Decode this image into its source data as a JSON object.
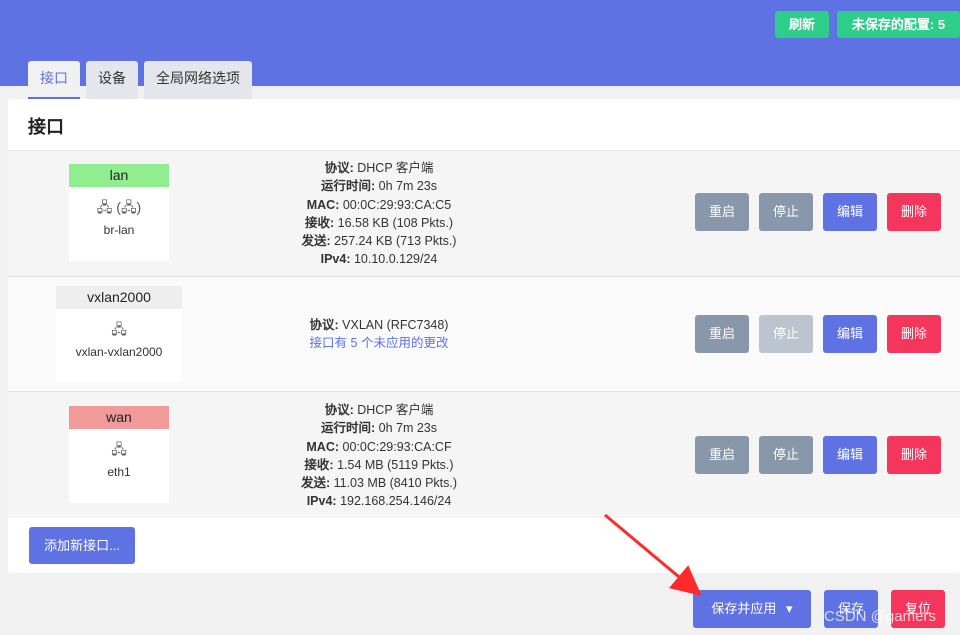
{
  "header": {
    "refresh_label": "刷新",
    "unsaved_label": "未保存的配置: 5"
  },
  "tabs": [
    {
      "label": "接口",
      "active": true
    },
    {
      "label": "设备",
      "active": false
    },
    {
      "label": "全局网络选项",
      "active": false
    }
  ],
  "panel": {
    "title": "接口"
  },
  "interfaces": [
    {
      "name": "lan",
      "badge_color": "#90ee90",
      "icons": "🖧 (🖧)",
      "device": "br-lan",
      "info": [
        {
          "k": "协议:",
          "v": " DHCP 客户端"
        },
        {
          "k": "运行时间:",
          "v": " 0h 7m 23s"
        },
        {
          "k": "MAC:",
          "v": " 00:0C:29:93:CA:C5"
        },
        {
          "k": "接收:",
          "v": " 16.58 KB (108 Pkts.)"
        },
        {
          "k": "发送:",
          "v": " 257.24 KB (713 Pkts.)"
        },
        {
          "k": "IPv4:",
          "v": " 10.10.0.129/24"
        }
      ],
      "stop_disabled": false
    },
    {
      "name": "vxlan2000",
      "badge_color": "#eeeeee",
      "icons": "🖧",
      "device": "vxlan-vxlan2000",
      "info": [
        {
          "k": "协议:",
          "v": " VXLAN (RFC7348)"
        }
      ],
      "note": "接口有 5 个未应用的更改",
      "stop_disabled": true
    },
    {
      "name": "wan",
      "badge_color": "#f09a9a",
      "icons": "🖧",
      "device": "eth1",
      "info": [
        {
          "k": "协议:",
          "v": " DHCP 客户端"
        },
        {
          "k": "运行时间:",
          "v": " 0h 7m 23s"
        },
        {
          "k": "MAC:",
          "v": " 00:0C:29:93:CA:CF"
        },
        {
          "k": "接收:",
          "v": " 1.54 MB (5119 Pkts.)"
        },
        {
          "k": "发送:",
          "v": " 11.03 MB (8410 Pkts.)"
        },
        {
          "k": "IPv4:",
          "v": " 192.168.254.146/24"
        }
      ],
      "stop_disabled": false
    }
  ],
  "actions": {
    "restart": "重启",
    "stop": "停止",
    "edit": "编辑",
    "delete": "删除"
  },
  "add_label": "添加新接口...",
  "footer": {
    "save_apply": "保存并应用",
    "caret": "▾",
    "save": "保存",
    "reset": "复位"
  },
  "watermark": "CSDN @gamers"
}
